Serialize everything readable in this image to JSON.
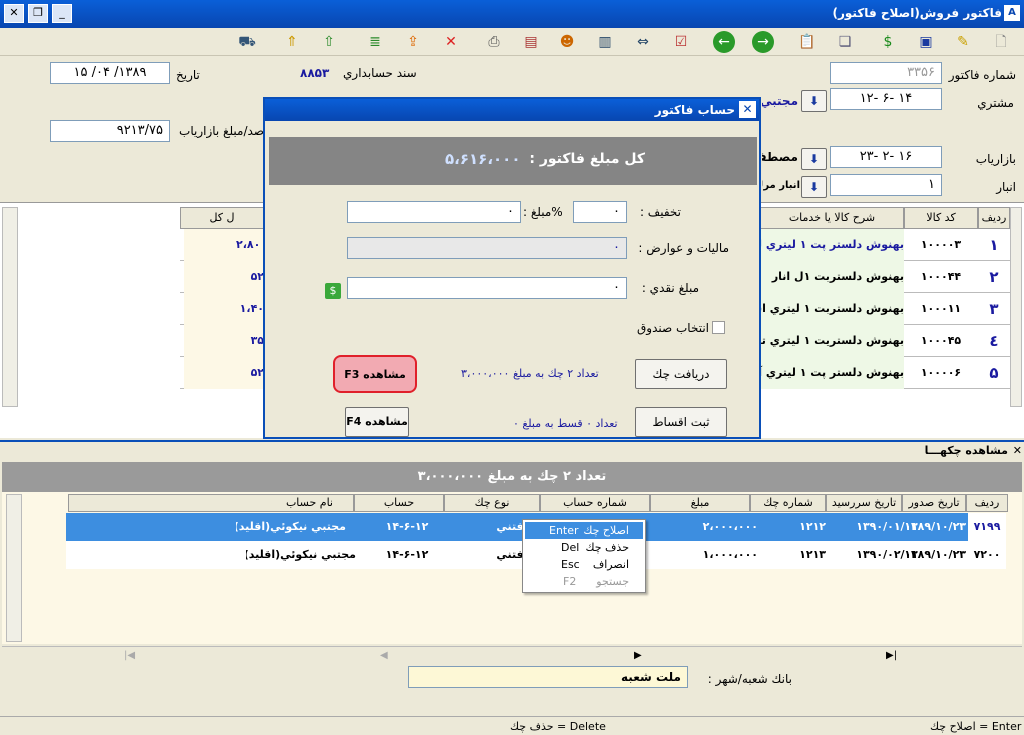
{
  "window": {
    "title": "فاكتور فروش(اصلاح فاكتور)"
  },
  "form": {
    "invoice_no_label": "شماره فاكتور",
    "invoice_no": "۳۳۵۶",
    "date_label": "تاريخ",
    "date": "۱۳۸۹/ ۰۴/ ۱۵",
    "doc_label": "سند حسابداري",
    "doc_no": "۸۸۵۳",
    "customer_label": "مشتري",
    "customer_code": "۱۴   -۶   -۱۲",
    "customer_name": "مجتبي ني",
    "pct_label": "صد/مبلغ بازاریاب",
    "pct_value": "۹۲۱۳/۷۵",
    "marketer_label": "بازاریاب",
    "marketer_code": "۱۶   -۲   -۲۳",
    "marketer_name": "مصطفي",
    "warehouse_label": "انبار",
    "warehouse_code": "۱",
    "warehouse_name": "انبار مرك"
  },
  "items": {
    "headers": {
      "row": "رديف",
      "code": "كد كالا",
      "desc": "شرح كالا يا خدمات",
      "total": "ل كل"
    },
    "rows": [
      {
        "row": "۱",
        "code": "۱۰۰۰۰۳",
        "desc": "بهنوش دلستر پت ۱ ليتري ليم",
        "total": "۲،۸۰"
      },
      {
        "row": "۲",
        "code": "۱۰۰۰۴۴",
        "desc": "بهنوش دلستربت ۱ل انار",
        "total": "۵۲"
      },
      {
        "row": "۳",
        "code": "۱۰۰۰۱۱",
        "desc": "بهنوش دلستربت ۱ ليتري اسـ",
        "total": "۱،۴۰"
      },
      {
        "row": "٤",
        "code": "۱۰۰۰۴۵",
        "desc": "بهنوش دلستريت ۱ ليتري تو",
        "total": "۳۵"
      },
      {
        "row": "۵",
        "code": "۱۰۰۰۰۶",
        "desc": "بهنوش دلستر پت ۱ ليتري آنا",
        "total": "۵۲"
      }
    ]
  },
  "dialog": {
    "title": "حساب فاكتور",
    "total_label": "كل مبلغ فاكتور :",
    "total_value": "۵،۶۱۶،۰۰۰",
    "discount_label": "تخفيف :",
    "discount_pct": "۰",
    "discount_amount_label": "%مبلغ :",
    "discount_amount": "۰",
    "tax_label": "ماليات و عوارض :",
    "tax_value": "۰",
    "cash_label": "مبلغ نقدي :",
    "cash_value": "۰",
    "cashbox_label": "انتخاب صندوق",
    "receive_check_btn": "دريافت چك",
    "checks_info": "تعداد ۲ چك به مبلغ ۳،۰۰۰،۰۰۰",
    "view_f3": "مشاهده F3",
    "installment_btn": "ثبت اقساط",
    "installments_info": "تعداد ۰ قسط به مبلغ ۰",
    "view_f4": "مشاهده F4"
  },
  "checks": {
    "title": "مشاهده چكهـــا",
    "summary": "تعداد ۲ چك به مبلغ ۳،۰۰۰،۰۰۰",
    "headers": {
      "row": "رديف",
      "issue_date": "تاريخ صدور",
      "due_date": "تاريخ سررسيد",
      "check_no": "شماره چك",
      "amount": "مبلغ",
      "account_no": "شماره حساب",
      "check_type": "نوع چك",
      "account": "حساب",
      "account_name": "نام حساب"
    },
    "rows": [
      {
        "row": "۷۱۹۹",
        "issue_date": "۱۳۸۹/۱۰/۲۳",
        "due_date": "۱۳۹۰/۰۱/۰۱",
        "check_no": "۱۲۱۲",
        "amount": "۲،۰۰۰،۰۰۰",
        "check_type": "يافتني",
        "account": "۱۴-۶-۱۲",
        "account_name": "مجتبي نيكوئي(اقليد)"
      },
      {
        "row": "۷۲۰۰",
        "issue_date": "۱۳۸۹/۱۰/۲۳",
        "due_date": "۱۳۹۰/۰۲/۰۱",
        "check_no": "۱۲۱۳",
        "amount": "۱،۰۰۰،۰۰۰",
        "check_type": "يافتني",
        "account": "۱۴-۶-۱۲",
        "account_name": "مجتبي نيكوئي(اقليد)"
      }
    ],
    "bank_label": "بانك شعبه/شهر :",
    "bank_value": "ملت شعبه"
  },
  "context_menu": {
    "items": [
      {
        "label": "اصلاح چك",
        "key": "Enter"
      },
      {
        "label": "حذف چك",
        "key": "Del"
      },
      {
        "label": "انصراف",
        "key": "Esc"
      },
      {
        "label": "جستجو",
        "key": "F2"
      }
    ]
  },
  "status": {
    "left": "حذف چك = Delete",
    "right": "اصلاح چك = Enter"
  }
}
